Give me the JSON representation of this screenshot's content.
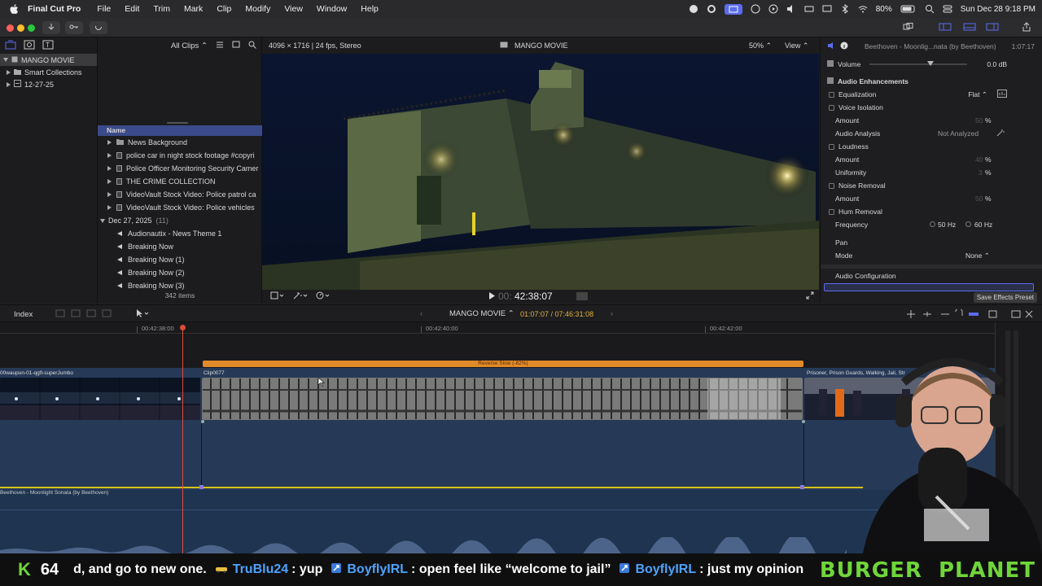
{
  "menubar": {
    "app_name": "Final Cut Pro",
    "items": [
      "File",
      "Edit",
      "Trim",
      "Mark",
      "Clip",
      "Modify",
      "View",
      "Window",
      "Help"
    ],
    "battery": "80%",
    "datetime": "Sun Dec 28  9:18 PM"
  },
  "library": {
    "items": [
      {
        "label": "MANGO MOVIE"
      },
      {
        "label": "Smart Collections"
      },
      {
        "label": "12-27-25"
      }
    ]
  },
  "browser": {
    "filter": "All Clips",
    "column_name": "Name",
    "rows": [
      {
        "label": "News Background",
        "kind": "folder"
      },
      {
        "label": "police  car in night stock footage #copyri",
        "kind": "video"
      },
      {
        "label": "Police Officer Monitoring Security Camer",
        "kind": "video"
      },
      {
        "label": "THE CRIME COLLECTION",
        "kind": "video"
      },
      {
        "label": "VideoVault Stock Video:   Police patrol ca",
        "kind": "video"
      },
      {
        "label": "VideoVault Stock Video:   Police vehicles",
        "kind": "video"
      }
    ],
    "group": {
      "label": "Dec 27, 2025",
      "count": "(11)"
    },
    "audio_rows": [
      {
        "label": "Audionautix - News Theme 1"
      },
      {
        "label": "Breaking Now"
      },
      {
        "label": "Breaking Now (1)"
      },
      {
        "label": "Breaking Now (2)"
      },
      {
        "label": "Breaking Now (3)"
      }
    ],
    "item_count": "342 items"
  },
  "viewer": {
    "format": "4096 × 1716 | 24 fps, Stereo",
    "title": "MANGO MOVIE",
    "zoom": "50%",
    "view_label": "View",
    "timecode_dim": "00:",
    "timecode": "42:38:07"
  },
  "inspector": {
    "clip_title": "Beethoven - Moonlig...nata (by Beethoven)",
    "duration": "1:07:17",
    "volume": {
      "label": "Volume",
      "value": "0.0 dB"
    },
    "section": "Audio Enhancements",
    "equalization": {
      "label": "Equalization",
      "value": "Flat"
    },
    "voice_isolation": "Voice Isolation",
    "vi_amount": {
      "label": "Amount",
      "value": "50",
      "unit": "%"
    },
    "audio_analysis": {
      "label": "Audio Analysis",
      "value": "Not Analyzed"
    },
    "loudness": "Loudness",
    "loud_amount": {
      "label": "Amount",
      "value": "40",
      "unit": "%"
    },
    "uniformity": {
      "label": "Uniformity",
      "value": "3",
      "unit": "%"
    },
    "noise_removal": "Noise Removal",
    "nr_amount": {
      "label": "Amount",
      "value": "50",
      "unit": "%"
    },
    "hum_removal": "Hum Removal",
    "frequency": {
      "label": "Frequency",
      "opt1": "50 Hz",
      "opt2": "60 Hz"
    },
    "pan": "Pan",
    "mode": {
      "label": "Mode",
      "value": "None"
    },
    "audio_config": "Audio Configuration",
    "save_preset": "Save Effects Preset"
  },
  "timeline": {
    "index_label": "Index",
    "project": "MANGO MOVIE",
    "timecode": "01:07:07 / 07:46:31:08",
    "ruler": [
      "00:42:38:00",
      "00:42:40:00",
      "00:42:42:00"
    ],
    "retime_label": "Reverse Slow (-82%)",
    "clips": [
      {
        "label": "00waupun-01-qgfl-superJumbo"
      },
      {
        "label": "Clip0077"
      },
      {
        "label": "Prisoner, Prison Guards, Walking, Jail, Str"
      }
    ],
    "audio_label": "Beethoven - Moonlight Sonata (by Beethoven)"
  },
  "overlay": {
    "k_letter": "K",
    "k_count": "64",
    "chat": [
      {
        "text": "d, and go to new one.",
        "kind": "msg"
      },
      {
        "text": "TruBlu24",
        "kind": "user"
      },
      {
        "text": ": yup",
        "kind": "msg"
      },
      {
        "text": "BoyflyIRL",
        "kind": "user"
      },
      {
        "text": ": open feel like “welcome to jail”",
        "kind": "msg"
      },
      {
        "text": "BoyflyIRL",
        "kind": "user"
      },
      {
        "text": ": just my opinion",
        "kind": "msg"
      }
    ],
    "brand": "BURGER  PLANET"
  },
  "colors": {
    "accent": "#5a6cf0",
    "retime": "#e08a2a",
    "audio_line": "#d8c21a",
    "playhead": "#e04a3a",
    "chat_user": "#4da3ff",
    "brand": "#6fd63a"
  }
}
